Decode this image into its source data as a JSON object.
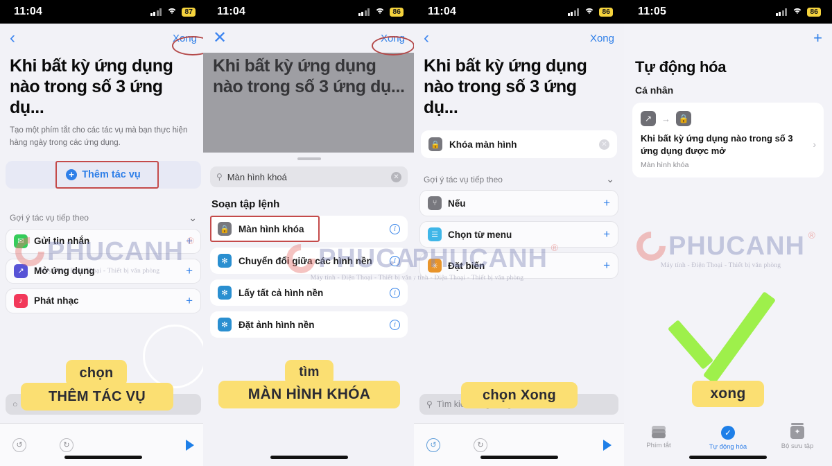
{
  "panels": [
    {
      "status": {
        "time": "11:04",
        "battery": "87"
      },
      "nav": {
        "back_icon": "chevron-left-icon",
        "done": "Xong"
      },
      "title": "Khi bất kỳ ứng dụng nào trong số 3 ứng dụ...",
      "description": "Tạo một phím tắt cho các tác vụ mà bạn thực hiện hàng ngày trong các ứng dụng.",
      "add_action": "Thêm tác vụ",
      "suggestions_header": "Gợi ý tác vụ tiếp theo",
      "suggestions": [
        {
          "label": "Gửi tin nhắn",
          "icon": "messages-icon",
          "color": "#35CC5A",
          "trailing": "+"
        },
        {
          "label": "Mở ứng dụng",
          "icon": "open-app-icon",
          "color": "#5753D6",
          "trailing": "+"
        },
        {
          "label": "Phát nhạc",
          "icon": "music-icon",
          "color": "#F2385A",
          "trailing": "+"
        }
      ],
      "annotation": {
        "line1": "chọn",
        "line2": "THÊM TÁC VỤ"
      }
    },
    {
      "status": {
        "time": "11:04",
        "battery": "86"
      },
      "nav": {
        "close_icon": "close-x-icon",
        "done": "Xong"
      },
      "title": "Khi bất kỳ ứng dụng nào trong số 3 ứng dụ...",
      "search": {
        "value": "Màn hình khoá",
        "icon": "search-icon",
        "clear": "clear-icon"
      },
      "section_title": "Soạn tập lệnh",
      "results": [
        {
          "label": "Màn hình khóa",
          "icon": "lock-icon",
          "color": "#78787E",
          "trailing": "info-icon"
        },
        {
          "label": "Chuyển đổi giữa các hình nền",
          "icon": "wallpaper-icon",
          "color": "#2A8FD0",
          "trailing": "info-icon"
        },
        {
          "label": "Lấy tất cả hình nền",
          "icon": "wallpaper-icon",
          "color": "#2A8FD0",
          "trailing": "info-icon"
        },
        {
          "label": "Đặt ảnh hình nền",
          "icon": "wallpaper-icon",
          "color": "#2A8FD0",
          "trailing": "info-icon"
        }
      ],
      "annotation": {
        "line1": "tìm",
        "line2": "MÀN HÌNH KHÓA"
      }
    },
    {
      "status": {
        "time": "11:04",
        "battery": "86"
      },
      "nav": {
        "back_icon": "chevron-left-icon",
        "done": "Xong"
      },
      "title": "Khi bất kỳ ứng dụng nào trong số 3 ứng dụ...",
      "selected_action": {
        "label": "Khóa màn hình",
        "icon": "lock-icon",
        "clear": "clear-icon"
      },
      "suggestions_header": "Gợi ý tác vụ tiếp theo",
      "suggestions": [
        {
          "label": "Nếu",
          "icon": "if-branch-icon",
          "color": "#78787E",
          "trailing": "+"
        },
        {
          "label": "Chọn từ menu",
          "icon": "menu-icon",
          "color": "#3FB6E8",
          "trailing": "+"
        },
        {
          "label": "Đặt biến",
          "icon": "variable-icon",
          "color": "#E8942A",
          "trailing": "+"
        }
      ],
      "search_placeholder": "Tìm kiếm ứng dụng và tác vụ",
      "annotation": {
        "line1": "",
        "line2": "chọn Xong"
      }
    },
    {
      "status": {
        "time": "11:05",
        "battery": "86"
      },
      "add_icon": "plus-icon",
      "title": "Tự động hóa",
      "section": "Cá nhân",
      "automation": {
        "trigger_icon": "app-open-icon",
        "arrow_icon": "arrow-right-icon",
        "action_icon": "lock-icon",
        "name": "Khi bất kỳ ứng dụng nào trong số 3 ứng dụng được mở",
        "detail": "Màn hình khóa",
        "chevron": "chevron-right-icon"
      },
      "annotation": {
        "line2": "xong"
      },
      "check_color": "#9EF04B",
      "tabs": [
        {
          "label": "Phím tắt",
          "icon": "shortcuts-stack-icon",
          "active": false
        },
        {
          "label": "Tự động hóa",
          "icon": "automation-check-icon",
          "active": true
        },
        {
          "label": "Bộ sưu tập",
          "icon": "gallery-box-icon",
          "active": false
        }
      ]
    }
  ],
  "watermark": {
    "brand": "PHUCANH",
    "registered": "®",
    "tagline": "Máy tính - Điện Thoại - Thiết bị văn phòng"
  }
}
